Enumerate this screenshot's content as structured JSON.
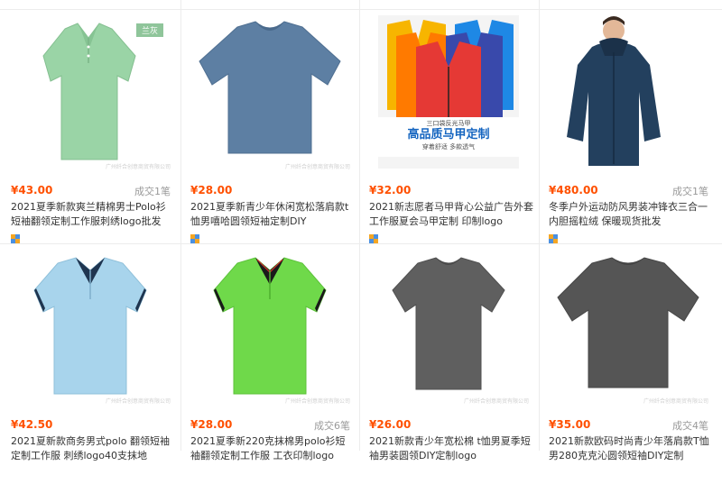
{
  "products": [
    {
      "price": "¥43.00",
      "deal": "成交1笔",
      "title": "2021夏季新款爽兰精棉男士Polo衫短袖翻领定制工作服刺绣logo批发",
      "tag": "兰灰",
      "watermark": "广州纤合创意商贸有限公司"
    },
    {
      "price": "¥28.00",
      "deal": "",
      "title": "2021夏季新青少年休闲宽松落肩款t恤男嘻哈圆领短袖定制DIY",
      "watermark": "广州纤合创意商贸有限公司"
    },
    {
      "price": "¥32.00",
      "deal": "",
      "title": "2021新志愿者马甲背心公益广告外套工作服夏会马甲定制 印制logo",
      "banner_top": "三口袋反光马甲",
      "banner_main": "高品质马甲定制",
      "banner_sub": "穿着舒适  多款透气"
    },
    {
      "price": "¥480.00",
      "deal": "成交1笔",
      "title": "冬季户外运动防风男装冲锋衣三合一内胆摇粒绒 保暖现货批发"
    },
    {
      "price": "¥42.50",
      "deal": "",
      "title": "2021夏新款商务男式polo 翻领短袖定制工作服 刺绣logo40支抹地",
      "watermark": "广州纤合创意商贸有限公司"
    },
    {
      "price": "¥28.00",
      "deal": "成交6笔",
      "title": "2021夏季新220克抹棉男polo衫短袖翻领定制工作服 工衣印制logo",
      "watermark": "广州纤合创意商贸有限公司"
    },
    {
      "price": "¥26.00",
      "deal": "",
      "title": "2021新款青少年宽松棉 t恤男夏季短袖男装圆领DIY定制logo",
      "watermark": "广州纤合创意商贸有限公司"
    },
    {
      "price": "¥35.00",
      "deal": "成交4笔",
      "title": "2021新款欧码时尚青少年落肩款T恤男280克克沁圆领短袖DIY定制",
      "watermark": "广州纤合创意商贸有限公司"
    }
  ],
  "colors": {
    "price": "#ff5000",
    "title": "#333333",
    "deal": "#999999"
  }
}
